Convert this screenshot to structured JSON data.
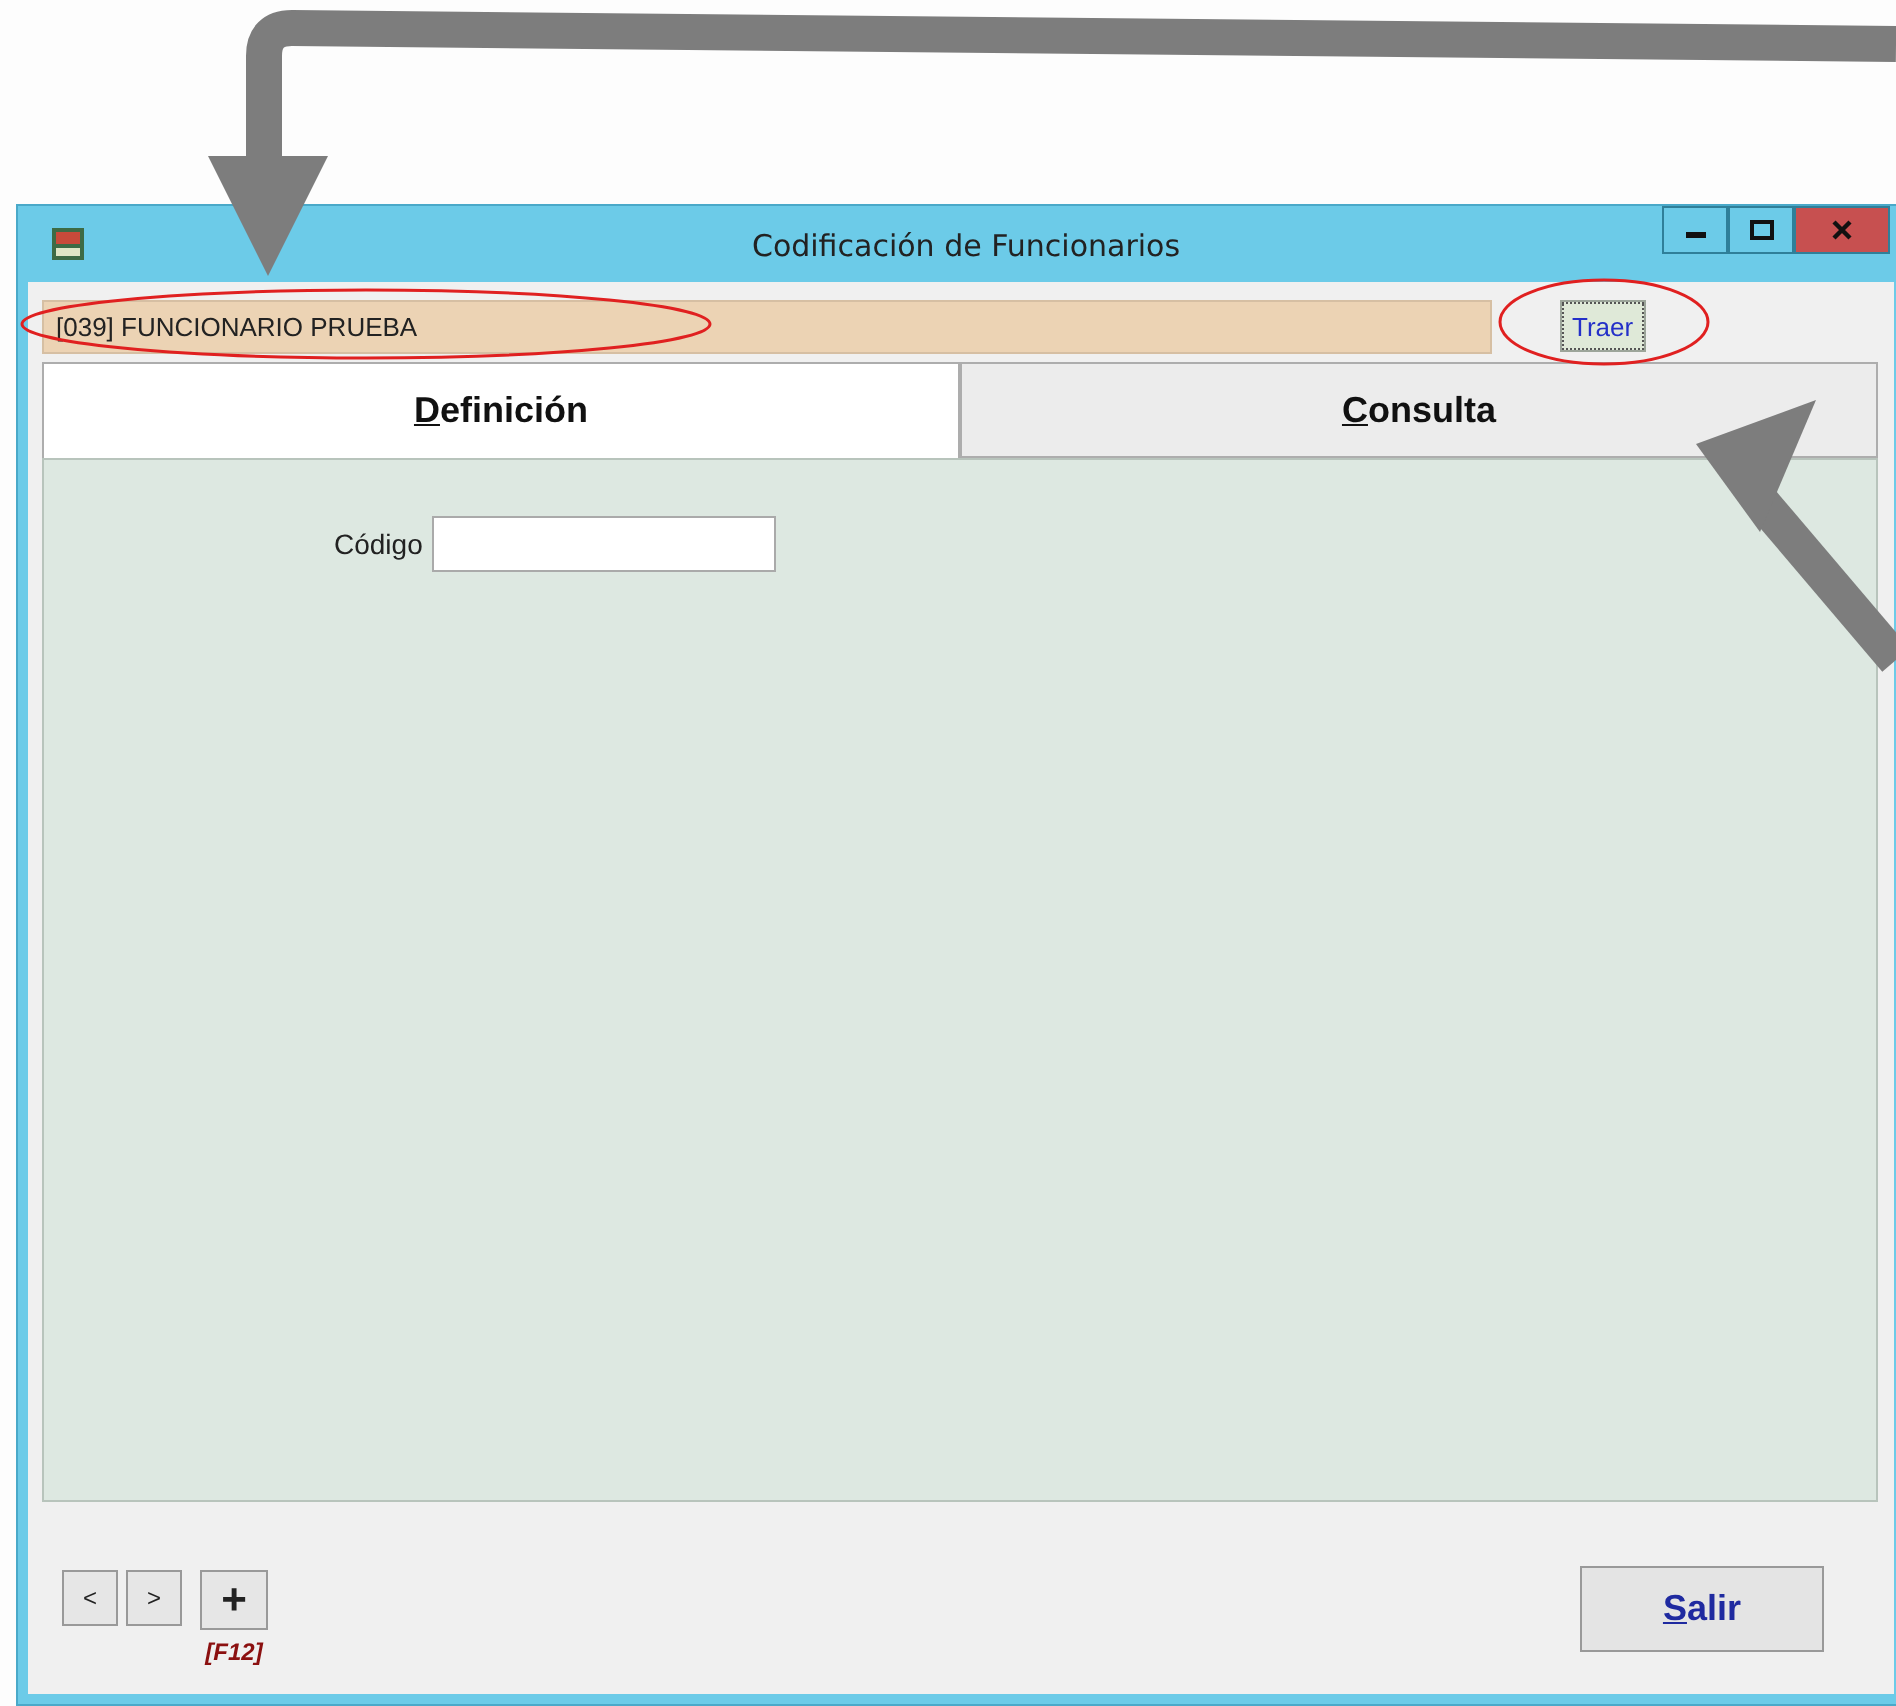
{
  "window": {
    "title": "Codificación de Funcionarios"
  },
  "record": {
    "value": "[039] FUNCIONARIO PRUEBA",
    "fetch_button": "Traer"
  },
  "tabs": [
    {
      "label": "Definición",
      "selected": true
    },
    {
      "label": "Consulta",
      "selected": false
    }
  ],
  "form": {
    "fields": [
      {
        "label": "Código"
      }
    ]
  },
  "footer": {
    "prev": "<",
    "next": ">",
    "add": "+",
    "add_shortcut": "[F12]",
    "exit": "Salir"
  }
}
